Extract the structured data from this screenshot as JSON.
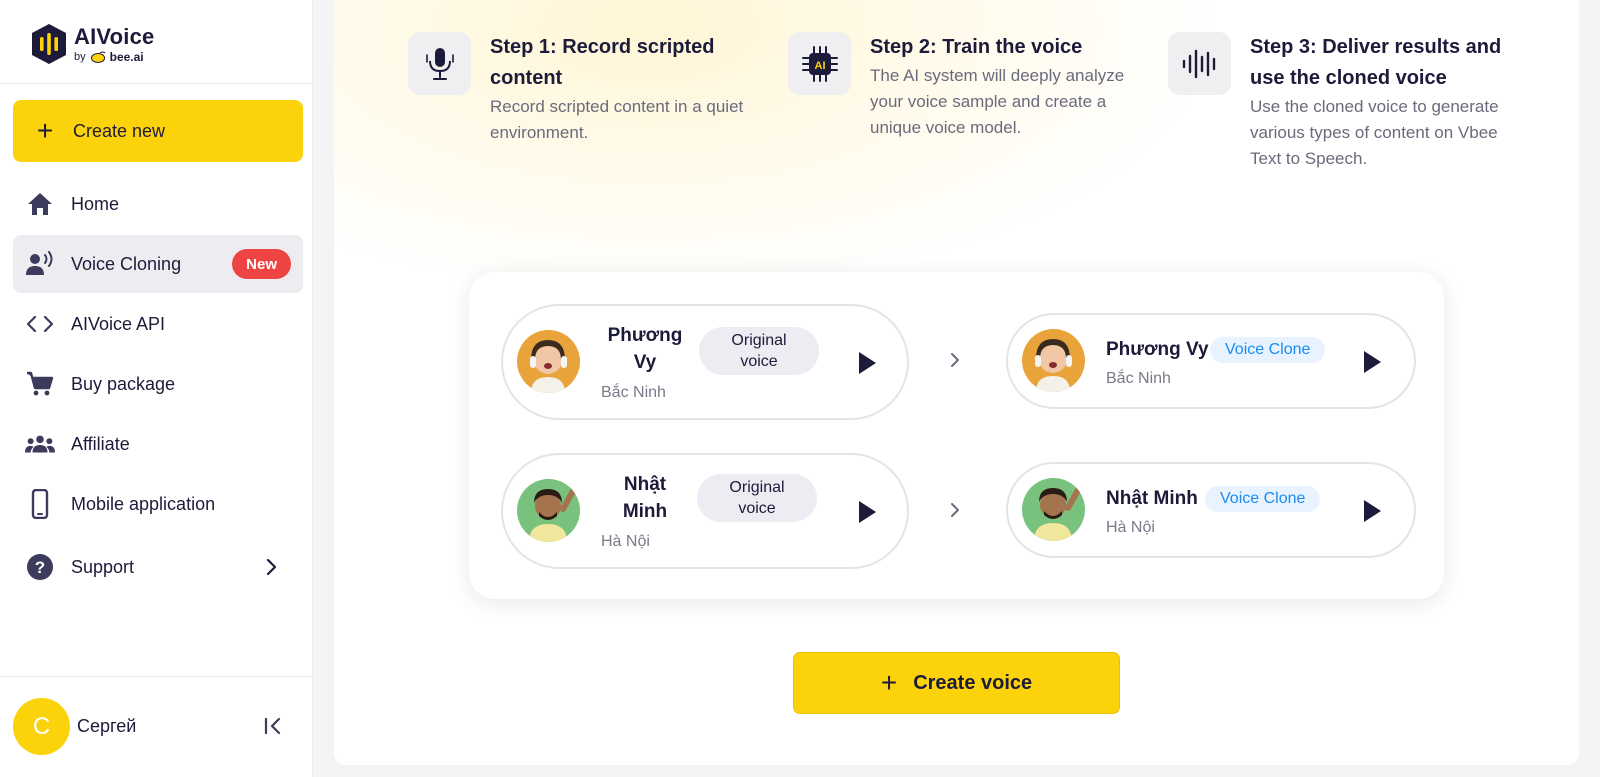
{
  "brand": {
    "title": "AIVoice",
    "by": "by",
    "partner": "bee.ai"
  },
  "sidebar": {
    "create_new": "Create new",
    "items": [
      {
        "label": "Home",
        "icon": "home-icon"
      },
      {
        "label": "Voice Cloning",
        "icon": "voice-cloning-icon",
        "badge": "New",
        "active": true
      },
      {
        "label": "AIVoice API",
        "icon": "code-icon"
      },
      {
        "label": "Buy package",
        "icon": "cart-icon"
      },
      {
        "label": "Affiliate",
        "icon": "group-icon"
      },
      {
        "label": "Mobile application",
        "icon": "phone-icon"
      },
      {
        "label": "Support",
        "icon": "help-icon"
      }
    ],
    "user": {
      "initial": "C",
      "name": "Сергей"
    }
  },
  "steps": [
    {
      "title": "Step 1: Record scripted content",
      "desc": "Record scripted content in a quiet environment.",
      "icon": "microphone-icon"
    },
    {
      "title": "Step 2: Train the voice",
      "desc": "The AI system will deeply analyze your voice sample and create a unique voice model.",
      "icon": "ai-chip-icon"
    },
    {
      "title": "Step 3: Deliver results and use the cloned voice",
      "desc": "Use the cloned voice to generate various types of content on Vbee Text to Speech.",
      "icon": "waveform-icon"
    }
  ],
  "samples": [
    {
      "original": {
        "name_line1": "Phương",
        "name_line2": "Vy",
        "location": "Bắc Ninh",
        "tag_line1": "Original",
        "tag_line2": "voice"
      },
      "clone": {
        "name": "Phương Vy",
        "location": "Bắc Ninh",
        "tag": "Voice Clone"
      }
    },
    {
      "original": {
        "name_line1": "Nhật",
        "name_line2": "Minh",
        "location": "Hà Nội",
        "tag_line1": "Original",
        "tag_line2": "voice"
      },
      "clone": {
        "name": "Nhật Minh",
        "location": "Hà Nội",
        "tag": "Voice Clone"
      }
    }
  ],
  "create_voice": "Create voice",
  "colors": {
    "accent": "#fcd30a",
    "navy": "#1d1b3a",
    "badge": "#ef4444",
    "clone_tag": "#1a8cf0"
  }
}
